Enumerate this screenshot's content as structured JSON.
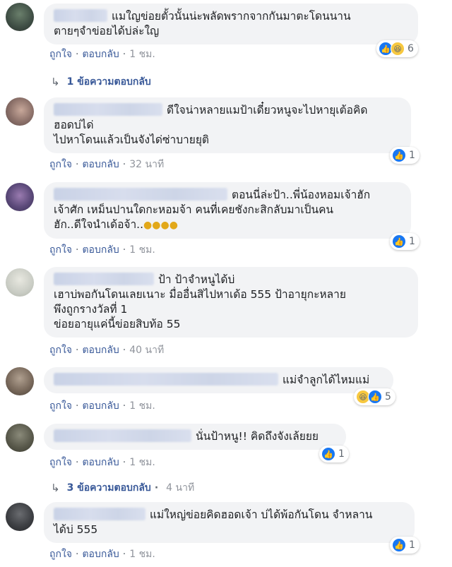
{
  "comments": [
    {
      "text": "แมใญข่อยตั้วนั้นน่ะพลัดพรากจากกันมาตะโดนนาน\nตายๆจำข่อยได้บ่ล่ะใญ",
      "like": "ถูกใจ",
      "reply": "ตอบกลับ",
      "time": "1 ชม.",
      "reaction_count": "6",
      "replies_label": "1 ข้อความตอบกลับ"
    },
    {
      "text": "ดีใจน่าหลายแมป้าเดี๋ยวหนูจะไปหายุเต้อคิด\nฮอดบ่ได่\nไปหาโดนแล้วเป็นจังได่ซ่าบายยุติ",
      "like": "ถูกใจ",
      "reply": "ตอบกลับ",
      "time": "32 นาที",
      "reaction_count": "1"
    },
    {
      "text": "ตอนนี่ล่ะป้า..พี่น้องหอมเจ้าฮัก\nเจ้าศัก เหม็นปานใดกะหอมจ้า คนที่เคยชังกะสิกลับมาเป็นคน\nฮัก..ดีใจนำเด้อจ้า..",
      "like": "ถูกใจ",
      "reply": "ตอบกลับ",
      "time": "1 ชม.",
      "reaction_count": "1"
    },
    {
      "text": "ป้า ป้าจำหนูได้บ่\nเฮาบ่พอกันโดนเลยเนาะ มื่ออื่นสิไปหาเด้อ 555 ป้าอายุกะหลาย\nพึงถูกรางวัลที่ 1\nข่อยอายุแค่นี้ข่อยสิบท้อ 55",
      "like": "ถูกใจ",
      "reply": "ตอบกลับ",
      "time": "40 นาที"
    },
    {
      "text": "แม่จำลูกได้ไหมแม่",
      "like": "ถูกใจ",
      "reply": "ตอบกลับ",
      "time": "1 ชม.",
      "reaction_count": "5"
    },
    {
      "text": "นั่นป้าหนู!! คิดถึงจังเล้ยยย",
      "like": "ถูกใจ",
      "reply": "ตอบกลับ",
      "time": "1 ชม.",
      "reaction_count": "1",
      "replies_label": "3 ข้อความตอบกลับ",
      "replies_time": "4 นาที"
    },
    {
      "text": "แม่ใหญ่ข่อยคิดฮอดเจ้า บ่ได้พ้อกันโดน จำหลาน\nได้บ่ 555",
      "like": "ถูกใจ",
      "reply": "ตอบกลับ",
      "time": "1 ชม.",
      "reaction_count": "1"
    }
  ],
  "colors": {
    "link": "#385898",
    "bubble": "#f2f3f5",
    "like": "#1877f2",
    "haha": "#f7c83f"
  },
  "icons": {
    "reply_arrow": "reply-arrow-icon",
    "like": "like-icon",
    "haha": "haha-icon"
  }
}
